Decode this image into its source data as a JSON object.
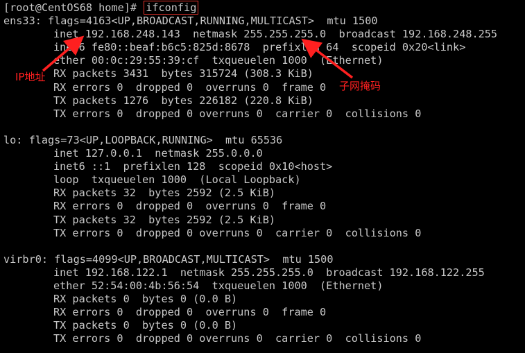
{
  "terminal": {
    "prompt": "[root@CentOS68 home]#",
    "command": "ifconfig",
    "lines": [
      {
        "indent": false,
        "text": "ens33: flags=4163<UP,BROADCAST,RUNNING,MULTICAST>  mtu 1500"
      },
      {
        "indent": true,
        "text": "inet 192.168.248.143  netmask 255.255.255.0  broadcast 192.168.248.255"
      },
      {
        "indent": true,
        "text": "inet6 fe80::beaf:b6c5:825d:8678  prefixlen 64  scopeid 0x20<link>"
      },
      {
        "indent": true,
        "text": "ether 00:0c:29:55:39:cf  txqueuelen 1000  (Ethernet)"
      },
      {
        "indent": true,
        "text": "RX packets 3431  bytes 315724 (308.3 KiB)"
      },
      {
        "indent": true,
        "text": "RX errors 0  dropped 0  overruns 0  frame 0"
      },
      {
        "indent": true,
        "text": "TX packets 1276  bytes 226182 (220.8 KiB)"
      },
      {
        "indent": true,
        "text": "TX errors 0  dropped 0 overruns 0  carrier 0  collisions 0"
      },
      {
        "indent": false,
        "text": ""
      },
      {
        "indent": false,
        "text": "lo: flags=73<UP,LOOPBACK,RUNNING>  mtu 65536"
      },
      {
        "indent": true,
        "text": "inet 127.0.0.1  netmask 255.0.0.0"
      },
      {
        "indent": true,
        "text": "inet6 ::1  prefixlen 128  scopeid 0x10<host>"
      },
      {
        "indent": true,
        "text": "loop  txqueuelen 1000  (Local Loopback)"
      },
      {
        "indent": true,
        "text": "RX packets 32  bytes 2592 (2.5 KiB)"
      },
      {
        "indent": true,
        "text": "RX errors 0  dropped 0  overruns 0  frame 0"
      },
      {
        "indent": true,
        "text": "TX packets 32  bytes 2592 (2.5 KiB)"
      },
      {
        "indent": true,
        "text": "TX errors 0  dropped 0 overruns 0  carrier 0  collisions 0"
      },
      {
        "indent": false,
        "text": ""
      },
      {
        "indent": false,
        "text": "virbr0: flags=4099<UP,BROADCAST,MULTICAST>  mtu 1500"
      },
      {
        "indent": true,
        "text": "inet 192.168.122.1  netmask 255.255.255.0  broadcast 192.168.122.255"
      },
      {
        "indent": true,
        "text": "ether 52:54:00:4b:56:54  txqueuelen 1000  (Ethernet)"
      },
      {
        "indent": true,
        "text": "RX packets 0  bytes 0 (0.0 B)"
      },
      {
        "indent": true,
        "text": "RX errors 0  dropped 0  overruns 0  frame 0"
      },
      {
        "indent": true,
        "text": "TX packets 0  bytes 0 (0.0 B)"
      },
      {
        "indent": true,
        "text": "TX errors 0  dropped 0 overruns 0  carrier 0  collisions 0"
      }
    ]
  },
  "annotations": {
    "ip_label": "IP地址",
    "netmask_label": "子网掩码",
    "color": "#ff2020"
  },
  "colors": {
    "background": "#000000",
    "text": "#c8c8c8",
    "highlight_box": "#e8312a"
  }
}
